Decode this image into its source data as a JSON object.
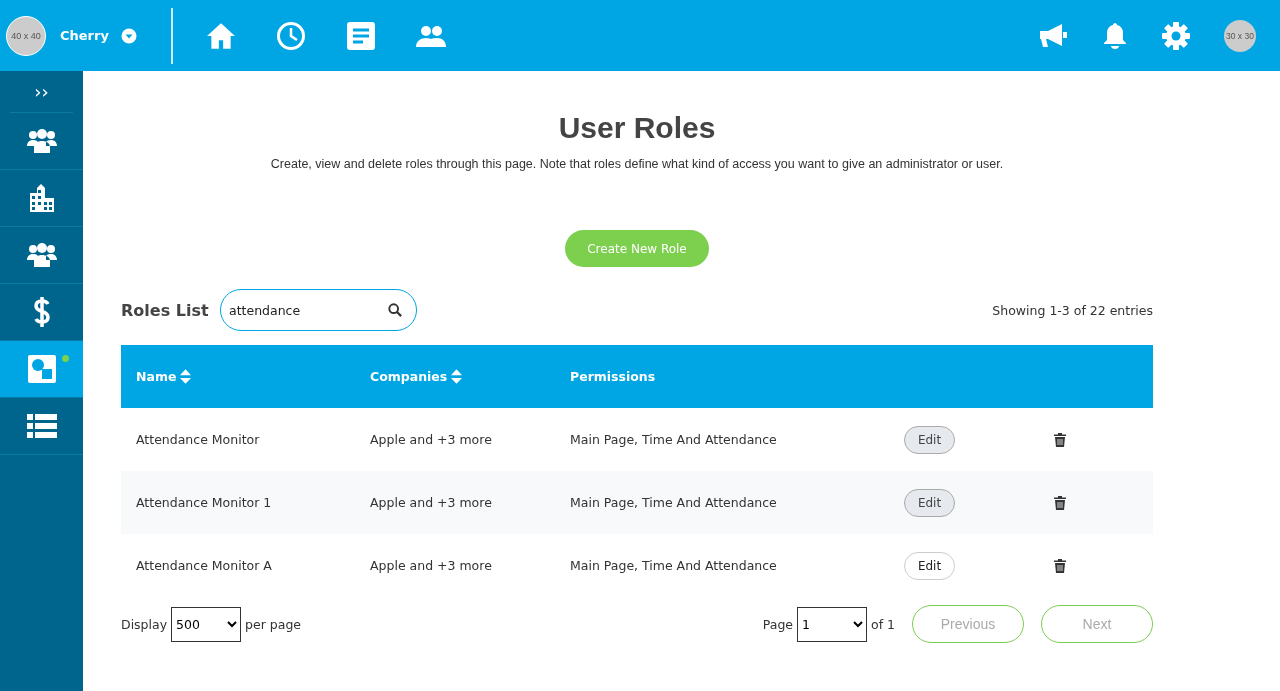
{
  "topbar": {
    "avatar": {
      "placeholder_text": "40 x 40"
    },
    "user_name": "Cherry",
    "nav": [
      {
        "kind": "home"
      },
      {
        "kind": "clock"
      },
      {
        "kind": "document"
      },
      {
        "kind": "people"
      }
    ],
    "actions": [
      {
        "kind": "megaphone"
      },
      {
        "kind": "bell"
      },
      {
        "kind": "gear"
      }
    ],
    "small_avatar": {
      "placeholder_text": "30 x 30"
    }
  },
  "sidebar": {
    "toggle": "››",
    "items": [
      {
        "kind": "group",
        "selected": false,
        "badge": false
      },
      {
        "kind": "building",
        "selected": false,
        "badge": false
      },
      {
        "kind": "group",
        "selected": false,
        "badge": false
      },
      {
        "kind": "dollar",
        "selected": false,
        "badge": false
      },
      {
        "kind": "shapes",
        "selected": true,
        "badge": true
      },
      {
        "kind": "list",
        "selected": false,
        "badge": false
      }
    ]
  },
  "page": {
    "title": "User Roles",
    "description": "Create, view and delete roles through this page. Note that roles define what kind of access you want to give an administrator or user.",
    "create_button": "Create New Role"
  },
  "roles_list": {
    "heading": "Roles List",
    "search": {
      "value": "attendance"
    },
    "entries_info": "Showing 1-3 of 22 entries"
  },
  "table": {
    "columns": [
      {
        "label": "Name",
        "sortable": true
      },
      {
        "label": "Companies",
        "sortable": true
      },
      {
        "label": "Permissions",
        "sortable": false
      }
    ],
    "rows": [
      {
        "name": "Attendance Monitor",
        "companies": "Apple and +3 more",
        "permissions": "Main Page, Time And Attendance",
        "edit": "Edit",
        "hovered": false
      },
      {
        "name": "Attendance Monitor 1",
        "companies": "Apple and +3 more",
        "permissions": "Main Page, Time And Attendance",
        "edit": "Edit",
        "hovered": false
      },
      {
        "name": "Attendance Monitor A",
        "companies": "Apple and +3 more",
        "permissions": "Main Page, Time And Attendance",
        "edit": "Edit",
        "hovered": true
      }
    ]
  },
  "footer": {
    "display_label": "Display",
    "page_size": "500",
    "per_page_label": "per page",
    "page_label": "Page",
    "page": "1",
    "of_label": "of 1",
    "previous": {
      "label": "Previous",
      "disabled": true
    },
    "next": {
      "label": "Next",
      "disabled": true
    }
  }
}
